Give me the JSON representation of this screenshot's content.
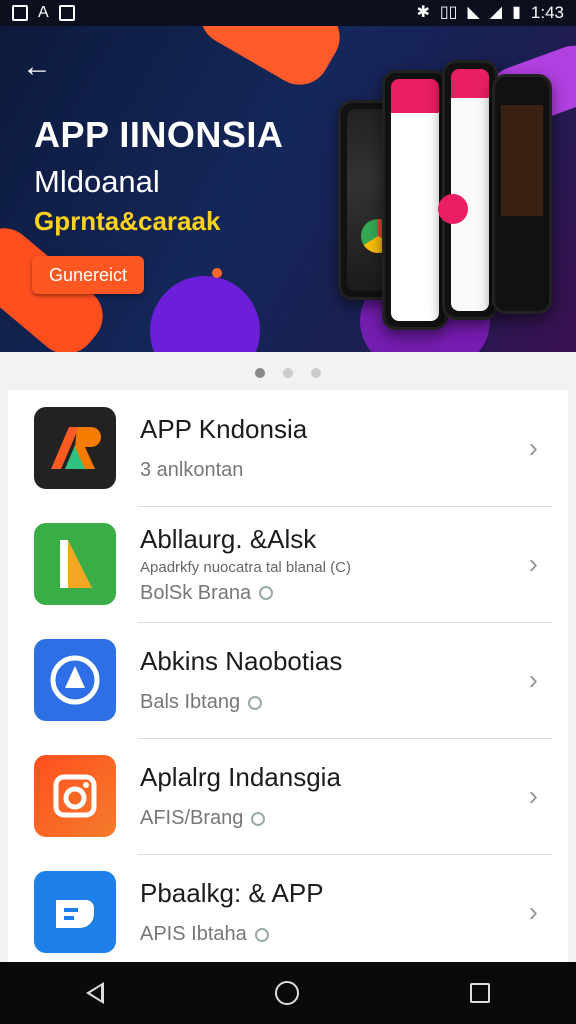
{
  "status": {
    "time": "1:43",
    "left_icons": [
      "sim-icon",
      "a-icon",
      "photo-icon"
    ],
    "right_icons": [
      "bluetooth-icon",
      "vibrate-icon",
      "wifi-icon",
      "signal-icon",
      "battery-icon"
    ]
  },
  "banner": {
    "title": "APP IINONSIA",
    "subtitle1": "Mldoanal",
    "subtitle2": "Gprnta&caraak",
    "button_label": "Gunereict",
    "back_icon": "back-arrow-icon"
  },
  "carousel": {
    "pages": 3,
    "active": 0
  },
  "apps": [
    {
      "title": "APP Kndonsia",
      "subtitle": "3 anlkontan",
      "desc": "",
      "sub_badge": false,
      "icon_color": "#222222",
      "icon_glyph": "A"
    },
    {
      "title": "Abllaurg. &Alsk",
      "desc": "Apadrkfy nuocatra tal blanal (C)",
      "subtitle": "BolSk Brana",
      "sub_badge": true,
      "icon_color": "#3aae46",
      "icon_glyph": "∧"
    },
    {
      "title": "Abkins Naobotias",
      "subtitle": "Bals Ibtang",
      "desc": "",
      "sub_badge": true,
      "icon_color": "#2f6fe6",
      "icon_glyph": "▲"
    },
    {
      "title": "Aplalrg Indansgia",
      "subtitle": "AFIS/Brang",
      "desc": "",
      "sub_badge": true,
      "icon_color": "#f15a24",
      "icon_glyph": "▣"
    },
    {
      "title": "Pbaalkg: & APP",
      "subtitle": "APIS Ibtaha",
      "desc": "",
      "sub_badge": true,
      "icon_color": "#1e7fe8",
      "icon_glyph": "◉"
    }
  ],
  "nav": {
    "back": "back-icon",
    "home": "home-icon",
    "recents": "recents-icon"
  }
}
